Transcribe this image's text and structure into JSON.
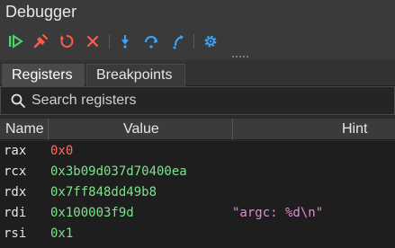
{
  "title": "Debugger",
  "toolbar": {
    "buttons": [
      {
        "name": "continue-icon",
        "color": "#4fd36a"
      },
      {
        "name": "clear-breakpoints-icon",
        "color": "#ff5a4d"
      },
      {
        "name": "restart-icon",
        "color": "#ff5a4d"
      },
      {
        "name": "stop-icon",
        "color": "#ff5a4d"
      },
      {
        "name": "step-over-icon",
        "color": "#39a7ff"
      },
      {
        "name": "step-into-icon",
        "color": "#39a7ff"
      },
      {
        "name": "step-out-icon",
        "color": "#39a7ff"
      },
      {
        "name": "gear-icon",
        "color": "#39a7ff"
      }
    ]
  },
  "tabs": [
    {
      "label": "Registers",
      "active": true
    },
    {
      "label": "Breakpoints",
      "active": false
    }
  ],
  "search": {
    "placeholder": "Search registers",
    "value": ""
  },
  "columns": {
    "name": "Name",
    "value": "Value",
    "hint": "Hint"
  },
  "colors": {
    "zero_value": "#ff6b5e",
    "value": "#7be38a",
    "hint": "#e08ad6"
  },
  "registers": [
    {
      "name": "rax",
      "value": "0x0",
      "hint": "",
      "zero": true
    },
    {
      "name": "rcx",
      "value": "0x3b09d037d70400ea",
      "hint": "",
      "zero": false
    },
    {
      "name": "rdx",
      "value": "0x7ff848dd49b8",
      "hint": "",
      "zero": false
    },
    {
      "name": "rdi",
      "value": "0x100003f9d",
      "hint": "\"argc: %d\\n\"",
      "zero": false
    },
    {
      "name": "rsi",
      "value": "0x1",
      "hint": "",
      "zero": false
    }
  ]
}
